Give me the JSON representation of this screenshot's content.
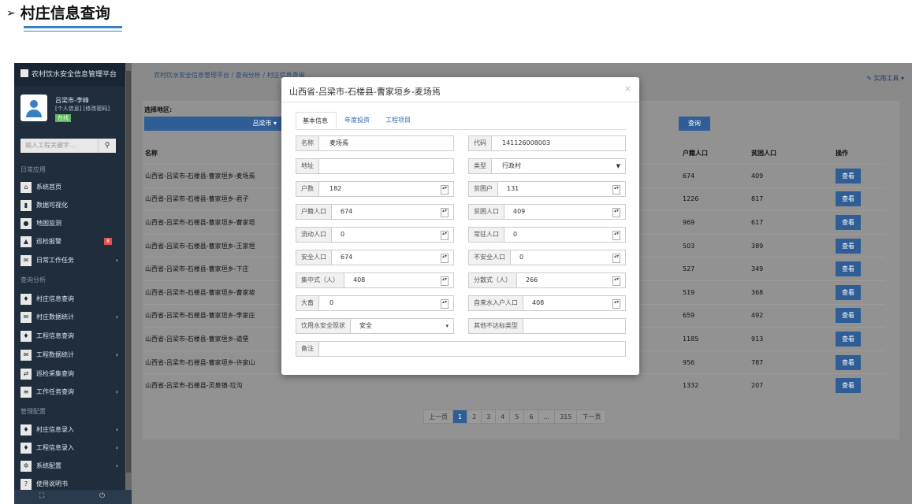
{
  "doc": {
    "heading": "村庄信息查询"
  },
  "sidebar": {
    "app_title": "农村饮水安全信息管理平台",
    "user_name": "吕梁市-李峰",
    "user_links": "[个人信息] [修改密码]",
    "status": "在线",
    "search_placeholder": "输入工程关键字...",
    "groups": [
      "日常应用",
      "查询分析",
      "管理配置"
    ],
    "items": [
      {
        "label": "系统首页",
        "icon": "home-icon"
      },
      {
        "label": "数据可视化",
        "icon": "chart-icon"
      },
      {
        "label": "地图监测",
        "icon": "map-pin-icon"
      },
      {
        "label": "巡检报警",
        "icon": "warning-icon",
        "badge": "8"
      },
      {
        "label": "日常工作任务",
        "icon": "mail-icon"
      },
      {
        "label": "村庄信息查询",
        "icon": "drop-icon"
      },
      {
        "label": "村庄数据统计",
        "icon": "mail-icon"
      },
      {
        "label": "工程信息查询",
        "icon": "drop-icon"
      },
      {
        "label": "工程数据统计",
        "icon": "mail-icon"
      },
      {
        "label": "巡检采集查询",
        "icon": "exchange-icon"
      },
      {
        "label": "工作任务查询",
        "icon": "list-icon"
      },
      {
        "label": "村庄信息录入",
        "icon": "drop-icon"
      },
      {
        "label": "工程信息录入",
        "icon": "drop-icon"
      },
      {
        "label": "系统配置",
        "icon": "gear-icon"
      },
      {
        "label": "使用说明书",
        "icon": "help-icon"
      }
    ]
  },
  "breadcrumb": {
    "home": "农村饮水安全信息管理平台",
    "sep": "/",
    "level2": "查询分析",
    "current": "村庄信息查询"
  },
  "tools_label": "实用工具",
  "filter": {
    "region_label": "选择地区:",
    "region_value": "吕梁市",
    "search_button": "查询"
  },
  "table": {
    "headers": {
      "name": "名称",
      "huji": "户籍人口",
      "pinkun": "贫困人口",
      "ops": "操作"
    },
    "view_label": "查看",
    "rows": [
      {
        "name": "山西省-吕梁市-石楼县-曹家垣乡-麦场焉",
        "huji": "674",
        "pinkun": "409"
      },
      {
        "name": "山西省-吕梁市-石楼县-曹家垣乡-君子",
        "huji": "1226",
        "pinkun": "817"
      },
      {
        "name": "山西省-吕梁市-石楼县-曹家垣乡-曹家垣",
        "huji": "969",
        "pinkun": "617"
      },
      {
        "name": "山西省-吕梁市-石楼县-曹家垣乡-王家垣",
        "huji": "503",
        "pinkun": "389"
      },
      {
        "name": "山西省-吕梁市-石楼县-曹家垣乡-下庄",
        "huji": "527",
        "pinkun": "349"
      },
      {
        "name": "山西省-吕梁市-石楼县-曹家垣乡-曹家坡",
        "huji": "519",
        "pinkun": "368"
      },
      {
        "name": "山西省-吕梁市-石楼县-曹家垣乡-李家庄",
        "huji": "659",
        "pinkun": "492"
      },
      {
        "name": "山西省-吕梁市-石楼县-曹家垣乡-道堡",
        "huji": "1185",
        "pinkun": "913"
      },
      {
        "name": "山西省-吕梁市-石楼县-曹家垣乡-许家山",
        "huji": "956",
        "pinkun": "787"
      },
      {
        "name": "山西省-吕梁市-石楼县-灵泉镇-垃沟",
        "huji": "1332",
        "pinkun": "207"
      }
    ]
  },
  "pager": {
    "prev": "上一页",
    "pages": [
      "1",
      "2",
      "3",
      "4",
      "5",
      "6",
      "...",
      "315"
    ],
    "next": "下一页",
    "current": "1"
  },
  "modal": {
    "title": "山西省-吕梁市-石楼县-曹家垣乡-麦场焉",
    "close": "×",
    "tabs": [
      "基本信息",
      "年度投资",
      "工程项目"
    ],
    "fields": {
      "name": {
        "label": "名称",
        "value": "麦场焉"
      },
      "code": {
        "label": "代码",
        "value": "141126008003"
      },
      "address": {
        "label": "地址",
        "value": ""
      },
      "type": {
        "label": "类型",
        "value": "行政村"
      },
      "households": {
        "label": "户数",
        "value": "182"
      },
      "poor_households": {
        "label": "贫困户",
        "value": "131"
      },
      "registered_pop": {
        "label": "户籍人口",
        "value": "674"
      },
      "poor_pop": {
        "label": "贫困人口",
        "value": "409"
      },
      "floating_pop": {
        "label": "流动人口",
        "value": "0"
      },
      "resident_pop": {
        "label": "常驻人口",
        "value": "0"
      },
      "safe_pop": {
        "label": "安全人口",
        "value": "674"
      },
      "unsafe_pop": {
        "label": "不安全人口",
        "value": "0"
      },
      "centralized": {
        "label": "集中式（人）",
        "value": "408"
      },
      "dispersed": {
        "label": "分散式（人）",
        "value": "266"
      },
      "livestock": {
        "label": "大畜",
        "value": "0"
      },
      "tap_water": {
        "label": "自来水入户人口",
        "value": "408"
      },
      "water_status": {
        "label": "饮用水安全现状",
        "value": "安全"
      },
      "other_type": {
        "label": "其他不达标类型",
        "value": ""
      },
      "remark": {
        "label": "备注",
        "value": ""
      }
    }
  }
}
